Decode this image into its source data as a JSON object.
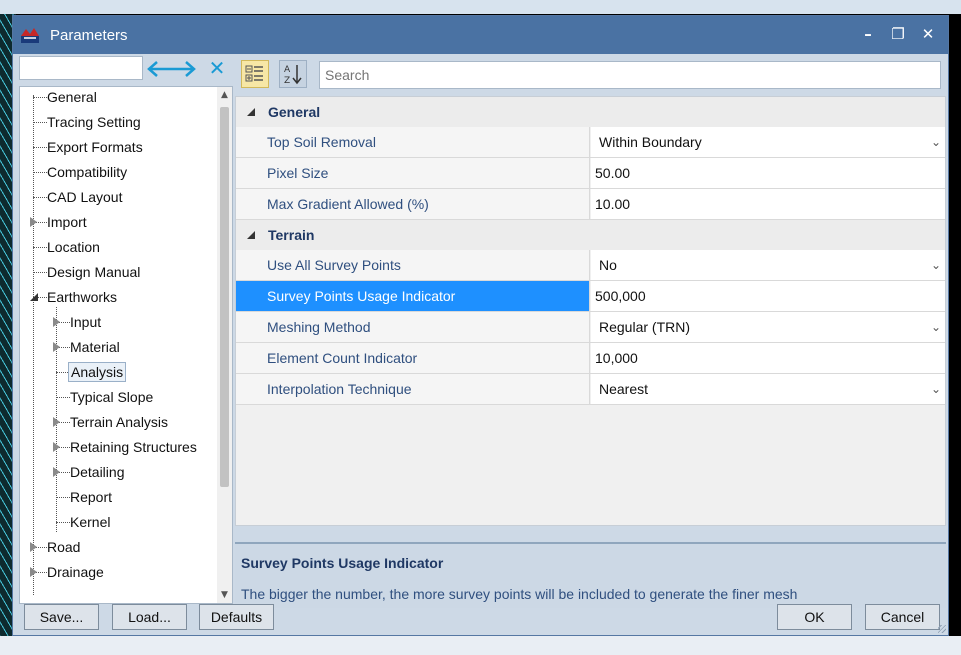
{
  "window": {
    "title": "Parameters",
    "controls": {
      "minimize": "–",
      "maximize": "❐",
      "close": "✕"
    }
  },
  "tree": {
    "filter": {
      "value": "",
      "placeholder": ""
    },
    "items": [
      {
        "label": "General",
        "level": 0,
        "expander": "none"
      },
      {
        "label": "Tracing Setting",
        "level": 0,
        "expander": "none"
      },
      {
        "label": "Export Formats",
        "level": 0,
        "expander": "none"
      },
      {
        "label": "Compatibility",
        "level": 0,
        "expander": "none"
      },
      {
        "label": "CAD Layout",
        "level": 0,
        "expander": "none"
      },
      {
        "label": "Import",
        "level": 0,
        "expander": "closed"
      },
      {
        "label": "Location",
        "level": 0,
        "expander": "none"
      },
      {
        "label": "Design Manual",
        "level": 0,
        "expander": "none"
      },
      {
        "label": "Earthworks",
        "level": 0,
        "expander": "open"
      },
      {
        "label": "Input",
        "level": 1,
        "expander": "closed"
      },
      {
        "label": "Material",
        "level": 1,
        "expander": "closed"
      },
      {
        "label": "Analysis",
        "level": 1,
        "expander": "none",
        "selected": true
      },
      {
        "label": "Typical Slope",
        "level": 1,
        "expander": "none"
      },
      {
        "label": "Terrain Analysis",
        "level": 1,
        "expander": "closed"
      },
      {
        "label": "Retaining Structures",
        "level": 1,
        "expander": "closed"
      },
      {
        "label": "Detailing",
        "level": 1,
        "expander": "closed"
      },
      {
        "label": "Report",
        "level": 1,
        "expander": "none"
      },
      {
        "label": "Kernel",
        "level": 1,
        "expander": "none"
      },
      {
        "label": "Road",
        "level": 0,
        "expander": "closed"
      },
      {
        "label": "Drainage",
        "level": 0,
        "expander": "closed"
      }
    ]
  },
  "grid": {
    "search_placeholder": "Search",
    "categories": [
      {
        "label": "General",
        "properties": [
          {
            "name": "Top Soil Removal",
            "value": "Within Boundary",
            "type": "combo"
          },
          {
            "name": "Pixel Size",
            "value": "50.00",
            "type": "text"
          },
          {
            "name": "Max Gradient Allowed (%)",
            "value": "10.00",
            "type": "text"
          }
        ]
      },
      {
        "label": "Terrain",
        "properties": [
          {
            "name": "Use All Survey Points",
            "value": "No",
            "type": "combo"
          },
          {
            "name": "Survey Points Usage Indicator",
            "value": "500,000",
            "type": "text",
            "selected": true
          },
          {
            "name": "Meshing Method",
            "value": "Regular (TRN)",
            "type": "combo"
          },
          {
            "name": "Element Count Indicator",
            "value": "10,000",
            "type": "text"
          },
          {
            "name": "Interpolation Technique",
            "value": "Nearest",
            "type": "combo"
          }
        ]
      }
    ]
  },
  "description": {
    "title": "Survey Points Usage Indicator",
    "text": "The bigger the number, the more survey points will be included to generate the finer mesh"
  },
  "buttons": {
    "save": "Save...",
    "load": "Load...",
    "defaults": "Defaults",
    "ok": "OK",
    "cancel": "Cancel"
  },
  "colors": {
    "title_bar": "#4a72a3",
    "selection": "#1e90ff",
    "category_text": "#1f3864",
    "property_text": "#2f4f7f"
  }
}
